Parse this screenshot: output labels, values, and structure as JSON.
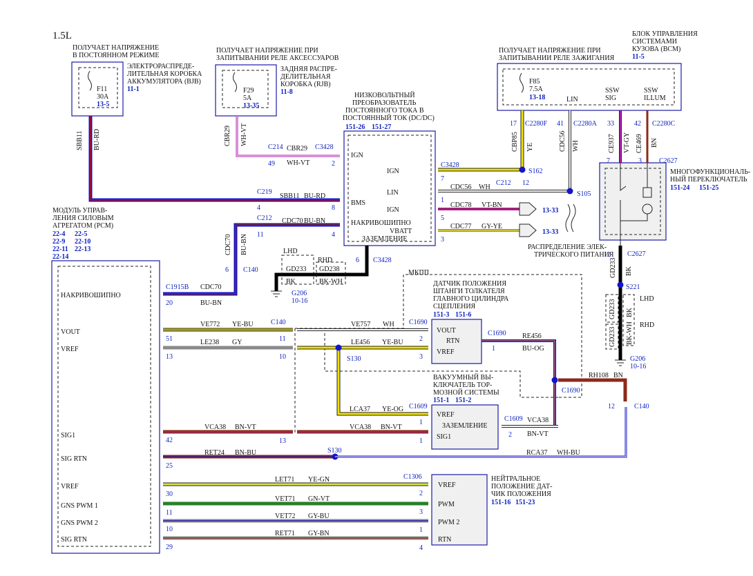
{
  "title": "1.5L",
  "top_blocks": [
    {
      "id": "bjb",
      "header": [
        "ПОЛУЧАЕТ НАПРЯЖЕНИЕ",
        "В ПОСТОЯННОМ РЕЖИМЕ"
      ],
      "name": [
        "ЭЛЕКТРОРАСПРЕДЕ-",
        "ЛИТЕЛЬНАЯ КОРОБКА",
        "АККУМУЛЯТОРА (BJB)"
      ],
      "ref": "11-1",
      "fuse": "F11",
      "amps": "30A",
      "page": "13-5"
    },
    {
      "id": "rjb",
      "header": [
        "ПОЛУЧАЕТ НАПРЯЖЕНИЕ ПРИ",
        "ЗАПИТЫВАНИИ РЕЛЕ АКСЕССУАРОВ"
      ],
      "name": [
        "ЗАДНЯЯ РАСПРЕ-",
        "ДЕЛИТЕЛЬНАЯ",
        "КОРОБКА (RJB)"
      ],
      "ref": "11-8",
      "fuse": "F29",
      "amps": "5A",
      "page": "13-35"
    },
    {
      "id": "bcm",
      "header": [
        "ПОЛУЧАЕТ НАПРЯЖЕНИЕ ПРИ",
        "ЗАПИТЫВАНИИ РЕЛЕ ЗАЖИГАНИЯ"
      ],
      "name": [
        "БЛОК УПРАВЛЕНИЯ",
        "СИСТЕМАМИ",
        "КУЗОВА (BCM)"
      ],
      "ref": "11-5",
      "fuse": "F85",
      "amps": "7.5A",
      "page": "13-18",
      "pins": [
        "LIN",
        "SSW",
        "SIG",
        "SSW",
        "ILLUM"
      ]
    }
  ],
  "dcdc": {
    "name": [
      "НИЗКОВОЛЬТНЫЙ",
      "ПРЕОБРАЗОВАТЕЛЬ",
      "ПОСТОЯННОГО ТОКА В",
      "ПОСТОЯННЫЙ ТОК (DC/DC)"
    ],
    "refs": [
      "151-26",
      "151-27"
    ],
    "pins_left": [
      "IGN",
      "BMS",
      "НАКРИВОШИПНО",
      "ЗАЗЕМЛЕНИЕ"
    ],
    "pins_right": [
      "IGN",
      "LIN",
      "IGN",
      "VBATT"
    ]
  },
  "pcm": {
    "name": [
      "МОДУЛЬ УПРАВ-",
      "ЛЕНИЯ СИЛОВЫМ",
      "АГРЕГАТОМ (PCM)"
    ],
    "refs": [
      "22-4",
      "22-5",
      "22-9",
      "22-10",
      "22-11",
      "22-13",
      "22-14"
    ],
    "pins": [
      "НАКРИВОШИПНО",
      "VOUT",
      "VREF",
      "SIG1",
      "SIG RTN",
      "VREF",
      "GNS PWM 1",
      "GNS PWM 2",
      "SIG RTN"
    ]
  },
  "sensors": [
    {
      "id": "clutch",
      "mkpp": "МКПП",
      "name": [
        "ДАТЧИК ПОЛОЖЕНИЯ",
        "ШТАНГИ ТОЛКАТЕЛЯ",
        "ГЛАВНОГО ЦИЛИНДРА",
        "СЦЕПЛЕНИЯ"
      ],
      "refs": [
        "151-3",
        "151-6"
      ],
      "pins": [
        "VOUT",
        "RTN",
        "VREF"
      ]
    },
    {
      "id": "brake",
      "name": [
        "ВАКУУМНЫЙ ВЫ-",
        "КЛЮЧАТЕЛЬ ТОР-",
        "МОЗНОЙ СИСТЕМЫ"
      ],
      "refs": [
        "151-1",
        "151-2"
      ],
      "pins": [
        "VREF",
        "ЗАЗЕМЛЕНИЕ",
        "SIG1"
      ]
    },
    {
      "id": "neutral",
      "name": [
        "НЕЙТРАЛЬНОЕ",
        "ПОЛОЖЕНИЕ ДАТ-",
        "ЧИК ПОЛОЖЕНИЯ"
      ],
      "refs": [
        "151-16",
        "151-23"
      ],
      "pins": [
        "VREF",
        "PWM",
        "PWM 2",
        "RTN"
      ]
    },
    {
      "id": "mfs",
      "name": [
        "МНОГОФУНКЦИОНАЛЬ-",
        "НЫЙ ПЕРЕКЛЮЧАТЕЛЬ"
      ],
      "refs": [
        "151-24",
        "151-25"
      ]
    }
  ],
  "power_dist": [
    "РАСПРЕДЕЛЕНИЕ ЭЛЕК-",
    "ТРИЧЕСКОГО ПИТАНИЯ"
  ],
  "ground": {
    "g206": "G206",
    "g206_ref": "10-16",
    "lhd": "LHD",
    "rhd": "RHD",
    "gd233": "GD233",
    "gd238": "GD238",
    "bk": "BK",
    "bkwh": "BK-WH"
  },
  "wires": [
    {
      "circuit": "SBB11",
      "color": "BU-RD"
    },
    {
      "circuit": "CBR29",
      "color": "WH-VT"
    },
    {
      "circuit": "CDC70",
      "color": "BU-BN"
    },
    {
      "circuit": "CBP85",
      "color": "YE"
    },
    {
      "circuit": "CDC56",
      "color": "WH"
    },
    {
      "circuit": "CDC78",
      "color": "VT-BN"
    },
    {
      "circuit": "CDC77",
      "color": "GY-YE"
    },
    {
      "circuit": "CE937",
      "color": "VT-GY"
    },
    {
      "circuit": "CE469",
      "color": "BN"
    },
    {
      "circuit": "GD233",
      "color": "BK"
    },
    {
      "circuit": "VE772",
      "color": "YE-BU"
    },
    {
      "circuit": "VE757",
      "color": "WH"
    },
    {
      "circuit": "LE238",
      "color": "GY"
    },
    {
      "circuit": "LE456",
      "color": "YE-BU"
    },
    {
      "circuit": "RE456",
      "color": "BU-OG"
    },
    {
      "circuit": "RH108",
      "color": "BN"
    },
    {
      "circuit": "LCA37",
      "color": "YE-OG"
    },
    {
      "circuit": "VCA38",
      "color": "BN-VT"
    },
    {
      "circuit": "RCA37",
      "color": "WH-BU"
    },
    {
      "circuit": "RET24",
      "color": "BN-BU"
    },
    {
      "circuit": "LET71",
      "color": "YE-GN"
    },
    {
      "circuit": "VET71",
      "color": "GN-VT"
    },
    {
      "circuit": "VET72",
      "color": "GY-BU"
    },
    {
      "circuit": "RET71",
      "color": "GY-BN"
    }
  ],
  "connectors": [
    "C214",
    "C3428",
    "C219",
    "C212",
    "C140",
    "C1915B",
    "C2280F",
    "C2280A",
    "C2280C",
    "C2627",
    "S243",
    "S138",
    "S221",
    "S130",
    "S162",
    "S105",
    "C1690",
    "C1609",
    "C1306"
  ],
  "page_refs": [
    "13-33",
    "13-33"
  ],
  "pin_numbers": {
    "c214": "49",
    "c3428_ign": "2",
    "c219": "4",
    "c219b": "8",
    "c212": "11",
    "c212b": "4",
    "c140_top": "6",
    "dc_7": "7",
    "dc_1": "1",
    "dc_5": "5",
    "dc_3": "3",
    "dc_6": "6",
    "c212_12": "12",
    "bcm_17": "17",
    "bcm_41": "41",
    "bcm_33": "33",
    "bcm_42": "42",
    "mfs_7": "7",
    "mfs_3": "3",
    "c2627_12": "12",
    "pcm": [
      "20",
      "51",
      "13",
      "42",
      "25",
      "30",
      "11",
      "10",
      "29"
    ],
    "c140": [
      "11",
      "10",
      "13",
      "12"
    ],
    "clutch": [
      "2",
      "3",
      "1"
    ],
    "brake": [
      "1",
      "2"
    ],
    "neutral": [
      "2",
      "3",
      "1",
      "4"
    ]
  },
  "colors": {
    "frame": "#1a1aa8",
    "ref": "#0b1fbf",
    "bu": "#1414c8",
    "rd": "#c01010",
    "ye": "#f0e200",
    "gy": "#8a8a8a",
    "bn": "#8b2a1a",
    "vt": "#b020b0",
    "gn": "#1a8a1a",
    "wh": "#ffffff",
    "bk": "#000000"
  }
}
